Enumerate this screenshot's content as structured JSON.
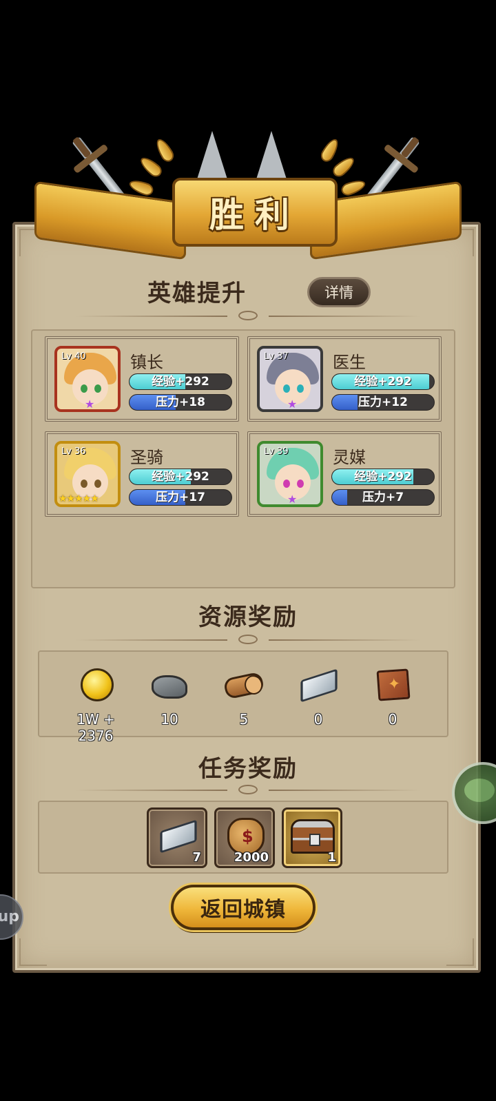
{
  "banner": {
    "title": "胜利"
  },
  "heroes_section": {
    "title": "英雄提升",
    "detail_label": "详情",
    "heroes": [
      {
        "name": "镇长",
        "level": "Lv 40",
        "exp": "经验+292",
        "exp_fill": 0.55,
        "pressure": "压力+18",
        "pressure_fill": 0.45,
        "frame_color": "#c0392b",
        "hair_color": "#e9a64a",
        "eye_color": "#3b9b4a"
      },
      {
        "name": "医生",
        "level": "Lv 37",
        "exp": "经验+292",
        "exp_fill": 0.95,
        "pressure": "压力+12",
        "pressure_fill": 0.25,
        "frame_color": "#5a5a5a",
        "hair_color": "#7d7f95",
        "eye_color": "#2bb0b8"
      },
      {
        "name": "圣骑",
        "level": "Lv 36",
        "exp": "经验+292",
        "exp_fill": 0.6,
        "pressure": "压力+17",
        "pressure_fill": 0.55,
        "frame_color": "#d4a21a",
        "hair_color": "#f1d06b",
        "eye_color": "#7a5a2a",
        "stars": "★★★★★"
      },
      {
        "name": "灵媒",
        "level": "Lv 39",
        "exp": "经验+292",
        "exp_fill": 0.8,
        "pressure": "压力+7",
        "pressure_fill": 0.15,
        "frame_color": "#4c9a3a",
        "hair_color": "#6fcfb0",
        "eye_color": "#d03cb0"
      }
    ]
  },
  "resources_section": {
    "title": "资源奖励",
    "items": [
      {
        "icon": "gold-coin-icon",
        "value": "1W + 2376"
      },
      {
        "icon": "stone-icon",
        "value": "10"
      },
      {
        "icon": "wood-log-icon",
        "value": "5"
      },
      {
        "icon": "iron-ingot-icon",
        "value": "0"
      },
      {
        "icon": "cloth-icon",
        "value": "0"
      }
    ]
  },
  "tasks_section": {
    "title": "任务奖励",
    "items": [
      {
        "icon": "iron-ingot-icon",
        "qty": "7"
      },
      {
        "icon": "money-bag-icon",
        "qty": "2000"
      },
      {
        "icon": "treasure-chest-icon",
        "qty": "1"
      }
    ]
  },
  "return_button": {
    "label": "返回城镇"
  },
  "floating_left": {
    "label": "up"
  }
}
